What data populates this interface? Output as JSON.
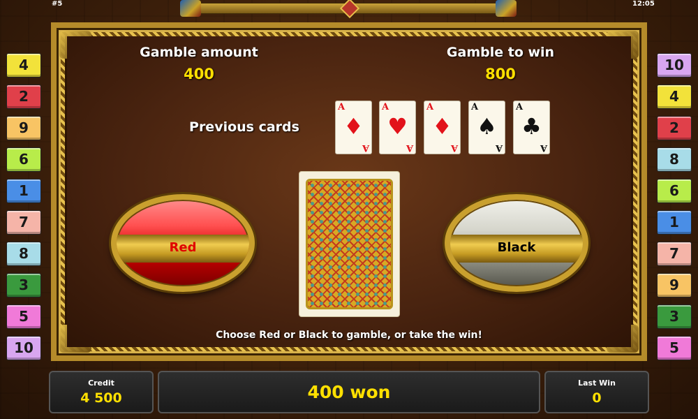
{
  "topbar": {
    "left_text": "#5",
    "time": "12:05"
  },
  "gamble": {
    "amount_label": "Gamble amount",
    "amount_value": "400",
    "win_label": "Gamble to win",
    "win_value": "800"
  },
  "previous": {
    "label": "Previous cards",
    "cards": [
      {
        "rank": "A",
        "suit": "diamonds",
        "symbol": "♦",
        "color": "red"
      },
      {
        "rank": "A",
        "suit": "hearts",
        "symbol": "♥",
        "color": "red"
      },
      {
        "rank": "A",
        "suit": "diamonds",
        "symbol": "♦",
        "color": "red"
      },
      {
        "rank": "A",
        "suit": "spades",
        "symbol": "♠",
        "color": "black"
      },
      {
        "rank": "A",
        "suit": "clubs",
        "symbol": "♣",
        "color": "black"
      }
    ]
  },
  "buttons": {
    "red_label": "Red",
    "black_label": "Black"
  },
  "message": "Choose Red or Black to gamble, or take the win!",
  "left_lines": [
    "4",
    "2",
    "9",
    "6",
    "1",
    "7",
    "8",
    "3",
    "5",
    "10"
  ],
  "right_lines": [
    "10",
    "4",
    "2",
    "8",
    "6",
    "1",
    "7",
    "9",
    "3",
    "5"
  ],
  "line_colors": {
    "1": "#4a8ee6",
    "2": "#e0404a",
    "3": "#3a9a3e",
    "4": "#f2e23a",
    "5": "#f07ad8",
    "6": "#b8ec4a",
    "7": "#f5b4a8",
    "8": "#a8dce8",
    "9": "#f8c464",
    "10": "#d8a6f0"
  },
  "bottom": {
    "credit_label": "Credit",
    "credit_value": "4 500",
    "status": "400 won",
    "lastwin_label": "Last Win",
    "lastwin_value": "0"
  }
}
